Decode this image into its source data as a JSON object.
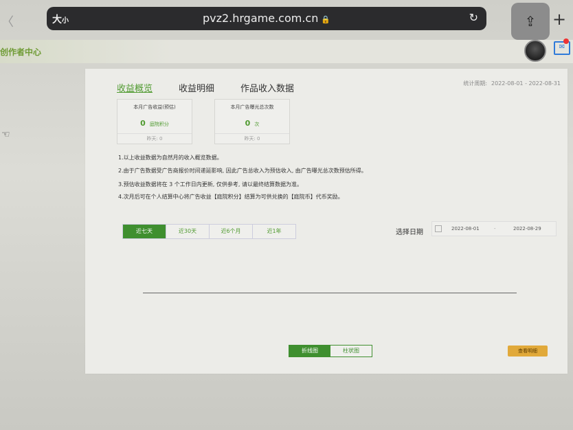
{
  "browser": {
    "size_label_big": "大",
    "size_label_small": "小",
    "url": "pvz2.hrgame.com.cn",
    "lock": "🔒",
    "reload": "↻"
  },
  "header": {
    "logo_text": "创作者中心"
  },
  "tabs": [
    {
      "label": "收益概览",
      "active": true
    },
    {
      "label": "收益明细",
      "active": false
    },
    {
      "label": "作品收入数据",
      "active": false
    }
  ],
  "period": {
    "label": "统计周期:",
    "value": "2022-08-01 - 2022-08-31"
  },
  "cards": [
    {
      "title": "本月广告收益(预估)",
      "value": "0",
      "unit": "庭院积分",
      "yesterday": "昨天: 0"
    },
    {
      "title": "本月广告曝光总次数",
      "value": "0",
      "unit": "次",
      "yesterday": "昨天: 0"
    }
  ],
  "notes": [
    "1.以上收益数据为自然月的收入概览数据。",
    "2.由于广告数据受广告商报价时间递延影响, 因此广告总收入为预估收入, 由广告曝光总次数预估所得。",
    "3.预估收益数据将在 3 个工作日内更新, 仅供参考, 请以最终结算数据为准。",
    "4.次月后可在个人结算中心将广告收益【庭院积分】结算为可供兑换的【庭院币】代币奖励。"
  ],
  "ranges": [
    {
      "label": "近七天",
      "active": true
    },
    {
      "label": "近30天",
      "active": false
    },
    {
      "label": "近6个月",
      "active": false
    },
    {
      "label": "近1年",
      "active": false
    }
  ],
  "date_filter": {
    "label": "选择日期",
    "start": "2022-08-01",
    "separator": "-",
    "end": "2022-08-29"
  },
  "view_toggle": [
    {
      "label": "折线图",
      "active": true
    },
    {
      "label": "柱状图",
      "active": false
    }
  ],
  "detail_button": "查看明细",
  "icons": [
    "lock-icon",
    "reload-icon",
    "share-icon",
    "plus-icon",
    "mail-icon",
    "calendar-icon",
    "back-chevron-icon"
  ],
  "colors": {
    "accent": "#3f8f2f",
    "warning": "#e1a93a"
  }
}
